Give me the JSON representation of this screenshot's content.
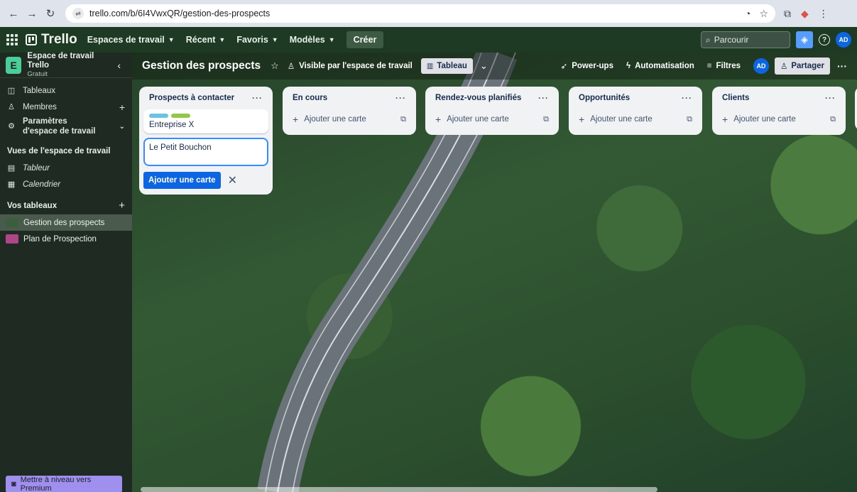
{
  "browser": {
    "url": "trello.com/b/6I4VwxQR/gestion-des-prospects",
    "site_info_icon": "site-info-icon"
  },
  "header": {
    "logo": "Trello",
    "nav": [
      "Espaces de travail",
      "Récent",
      "Favoris",
      "Modèles"
    ],
    "create_label": "Créer",
    "search_placeholder": "Parcourir",
    "avatar_initials": "AD"
  },
  "sidebar": {
    "workspace_initial": "E",
    "workspace_name": "Espace de travail Trello",
    "workspace_plan": "Gratuit",
    "items": [
      {
        "label": "Tableaux",
        "icon": "board-icon"
      },
      {
        "label": "Membres",
        "icon": "person-icon"
      },
      {
        "label": "Paramètres d'espace de travail",
        "icon": "gear-icon"
      }
    ],
    "views_title": "Vues de l'espace de travail",
    "views": [
      {
        "label": "Tableur",
        "icon": "table-icon"
      },
      {
        "label": "Calendrier",
        "icon": "calendar-icon"
      }
    ],
    "boards_title": "Vos tableaux",
    "boards": [
      {
        "label": "Gestion des prospects",
        "color": "#3b5f3c"
      },
      {
        "label": "Plan de Prospection",
        "color": "#ae4787"
      }
    ],
    "premium_label": "Mettre à niveau vers Premium"
  },
  "board": {
    "title": "Gestion des prospects",
    "visibility": "Visible par l'espace de travail",
    "view": "Tableau",
    "powerups": "Power-ups",
    "automation": "Automatisation",
    "filters": "Filtres",
    "avatar_initials": "AD",
    "share": "Partager"
  },
  "lists": [
    {
      "title": "Prospects à contacter",
      "cards": [
        {
          "text": "Entreprise X",
          "labels": [
            "#6cc3e0",
            "#94c748"
          ]
        }
      ],
      "composer_text": "Le Petit Bouchon",
      "composer_button": "Ajouter une carte"
    },
    {
      "title": "En cours",
      "add_label": "Ajouter une carte"
    },
    {
      "title": "Rendez-vous planifiés",
      "add_label": "Ajouter une carte"
    },
    {
      "title": "Opportunités",
      "add_label": "Ajouter une carte"
    },
    {
      "title": "Clients",
      "add_label": "Ajouter une carte"
    }
  ]
}
